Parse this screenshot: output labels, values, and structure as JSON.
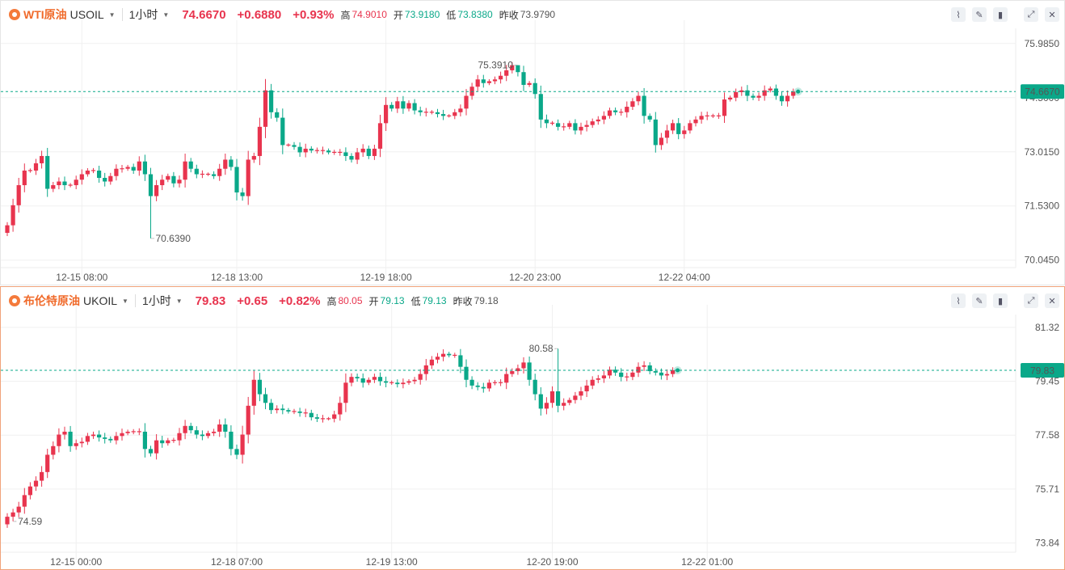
{
  "panels": [
    {
      "name": "WTI原油",
      "symbol": "USOIL",
      "period": "1小时",
      "price": "74.6670",
      "change": "+0.6880",
      "change_pct": "+0.93%",
      "high_label": "高",
      "high": "74.9010",
      "open_label": "开",
      "open": "73.9180",
      "low_label": "低",
      "low": "73.8380",
      "prev_label": "昨收",
      "prev_close": "73.9790",
      "current_price_tag": "74.6670"
    },
    {
      "name": "布伦特原油",
      "symbol": "UKOIL",
      "period": "1小时",
      "price": "79.83",
      "change": "+0.65",
      "change_pct": "+0.82%",
      "high_label": "高",
      "high": "80.05",
      "open_label": "开",
      "open": "79.13",
      "low_label": "低",
      "low": "79.13",
      "prev_label": "昨收",
      "prev_close": "79.18",
      "current_price_tag": "79.83"
    }
  ],
  "toolbar": {
    "icons": [
      "draw-line-icon",
      "pencil-icon",
      "candle-type-icon",
      "expand-icon",
      "close-icon"
    ]
  },
  "colors": {
    "up": "#e8344e",
    "down": "#0aa889",
    "brand": "#f06a2a"
  },
  "chart_data": [
    {
      "type": "candlestick",
      "title": "WTI原油 USOIL 1小时",
      "y_ticks": [
        70.045,
        71.53,
        73.015,
        74.5,
        75.985
      ],
      "y_tick_labels": [
        "70.0450",
        "71.5300",
        "73.0150",
        "74.5000",
        "75.9850"
      ],
      "ylim": [
        69.95,
        76.18
      ],
      "x_tick_labels": [
        "12-15 08:00",
        "12-18 13:00",
        "12-19 18:00",
        "12-20 23:00",
        "12-22 04:00"
      ],
      "x_tick_index": [
        13,
        40,
        66,
        92,
        118
      ],
      "max_annotation": {
        "label": "75.3910",
        "value": 75.391,
        "index": 89
      },
      "min_annotation": {
        "label": "70.6390",
        "value": 70.639,
        "index": 25
      },
      "last_price": 74.667,
      "closes": [
        71.0,
        71.55,
        72.1,
        72.5,
        72.5,
        72.7,
        72.9,
        72.0,
        72.1,
        72.2,
        72.1,
        72.1,
        72.25,
        72.4,
        72.5,
        72.5,
        72.3,
        72.2,
        72.35,
        72.55,
        72.55,
        72.6,
        72.5,
        72.75,
        72.4,
        71.8,
        72.1,
        72.25,
        72.35,
        72.15,
        72.25,
        72.75,
        72.55,
        72.4,
        72.4,
        72.4,
        72.35,
        72.55,
        72.8,
        72.6,
        71.9,
        71.8,
        72.8,
        72.9,
        73.7,
        74.7,
        74.1,
        73.95,
        73.2,
        73.2,
        73.15,
        73.0,
        73.1,
        73.05,
        73.05,
        73.05,
        73.0,
        73.0,
        73.0,
        72.9,
        72.8,
        73.0,
        73.1,
        72.9,
        73.1,
        73.8,
        74.3,
        74.2,
        74.4,
        74.2,
        74.35,
        74.15,
        74.1,
        74.1,
        74.1,
        74.05,
        74.0,
        74.0,
        74.1,
        74.2,
        74.55,
        74.8,
        75.0,
        74.9,
        74.95,
        75.0,
        75.1,
        75.25,
        75.39,
        75.2,
        74.85,
        74.9,
        74.6,
        73.9,
        73.8,
        73.8,
        73.7,
        73.7,
        73.8,
        73.6,
        73.7,
        73.75,
        73.85,
        73.9,
        74.0,
        74.15,
        74.1,
        74.1,
        74.25,
        74.4,
        74.55,
        74.0,
        73.9,
        73.2,
        73.4,
        73.6,
        73.8,
        73.5,
        73.6,
        73.8,
        73.9,
        74.0,
        74.0,
        74.0,
        74.0,
        74.45,
        74.5,
        74.65,
        74.7,
        74.55,
        74.5,
        74.55,
        74.7,
        74.75,
        74.55,
        74.4,
        74.55,
        74.667
      ]
    },
    {
      "type": "candlestick",
      "title": "布伦特原油 UKOIL 1小时",
      "y_ticks": [
        73.84,
        75.71,
        77.58,
        79.45,
        81.32
      ],
      "y_tick_labels": [
        "73.84",
        "75.71",
        "77.58",
        "79.45",
        "81.32"
      ],
      "ylim": [
        73.66,
        81.54
      ],
      "x_tick_labels": [
        "12-15 00:00",
        "12-18 07:00",
        "12-19 13:00",
        "12-20 19:00",
        "12-22 01:00"
      ],
      "x_tick_index": [
        12,
        40,
        67,
        95,
        122
      ],
      "max_annotation": {
        "label": "80.58",
        "value": 80.58,
        "index": 96
      },
      "min_annotation": {
        "label": "74.59",
        "value": 74.59,
        "index": 1
      },
      "last_price": 79.83,
      "closes": [
        74.75,
        74.9,
        75.1,
        75.5,
        75.8,
        76.0,
        76.3,
        76.9,
        77.2,
        77.6,
        77.7,
        77.2,
        77.3,
        77.35,
        77.55,
        77.6,
        77.5,
        77.45,
        77.4,
        77.55,
        77.65,
        77.7,
        77.7,
        77.7,
        77.1,
        76.95,
        77.4,
        77.3,
        77.4,
        77.4,
        77.65,
        77.9,
        77.75,
        77.6,
        77.55,
        77.65,
        77.7,
        77.95,
        77.7,
        77.1,
        76.9,
        77.6,
        78.6,
        79.5,
        79.0,
        78.7,
        78.45,
        78.5,
        78.45,
        78.4,
        78.4,
        78.35,
        78.35,
        78.2,
        78.15,
        78.15,
        78.15,
        78.3,
        78.7,
        79.4,
        79.6,
        79.55,
        79.4,
        79.5,
        79.6,
        79.45,
        79.4,
        79.4,
        79.35,
        79.4,
        79.45,
        79.5,
        79.7,
        80.0,
        80.2,
        80.3,
        80.4,
        80.35,
        80.35,
        79.95,
        79.5,
        79.3,
        79.25,
        79.2,
        79.4,
        79.4,
        79.4,
        79.7,
        79.8,
        79.9,
        80.1,
        79.5,
        79.0,
        78.5,
        78.7,
        79.1,
        78.6,
        78.7,
        78.8,
        78.95,
        79.1,
        79.3,
        79.5,
        79.55,
        79.65,
        79.85,
        79.75,
        79.6,
        79.6,
        79.75,
        79.95,
        80.0,
        79.8,
        79.75,
        79.65,
        79.7,
        79.83
      ]
    }
  ]
}
